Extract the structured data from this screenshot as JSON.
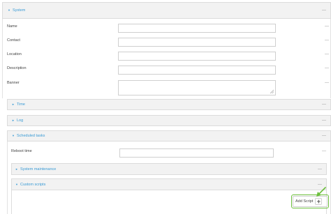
{
  "system": {
    "title": "System",
    "fields": [
      {
        "label": "Name",
        "value": ""
      },
      {
        "label": "Contact",
        "value": ""
      },
      {
        "label": "Location",
        "value": ""
      },
      {
        "label": "Description",
        "value": ""
      }
    ],
    "banner_label": "Banner",
    "banner_value": "",
    "dash": "—"
  },
  "time": {
    "title": "Time"
  },
  "log": {
    "title": "Log"
  },
  "scheduled_tasks": {
    "title": "Scheduled tasks",
    "reboot_label": "Reboot time",
    "reboot_value": "",
    "system_maintenance": {
      "title": "System maintenance"
    },
    "custom_scripts": {
      "title": "Custom scripts",
      "add_script_label": "Add Script"
    }
  },
  "icons": {
    "expanded": "caret-down-icon",
    "collapsed": "caret-right-icon",
    "add": "plus-icon",
    "remove": "dash-icon",
    "pointer": "green-arrow-icon"
  },
  "colors": {
    "accent": "#3a9bd5",
    "header_bg": "#f2f2f2",
    "highlight": "#6cbf3c"
  }
}
